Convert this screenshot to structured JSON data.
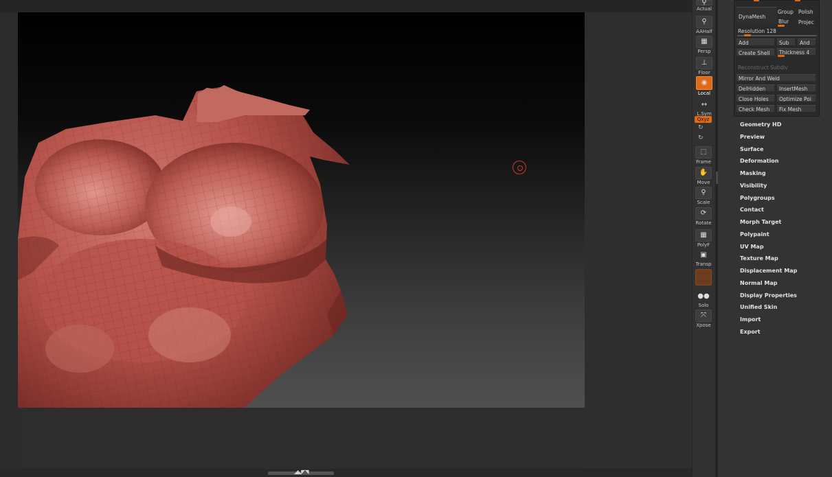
{
  "shelf": {
    "actual": "Actual",
    "aahalf": "AAHalf",
    "persp": "Persp",
    "floor": "Floor",
    "local": "Local",
    "lsym": "L.Sym",
    "xyz": "Qxyz",
    "frame": "Frame",
    "move": "Move",
    "scale": "Scale",
    "rotate": "Rotate",
    "polyf": "PolyF",
    "transp": "Transp",
    "solo": "Solo",
    "xpose": "Xpose"
  },
  "geometry": {
    "dynamesh": "DynaMesh",
    "group": "Group",
    "polish": "Polish",
    "blur": "Blur",
    "project": "Projec",
    "resolution": "Resolution 128",
    "add": "Add",
    "sub": "Sub",
    "and": "And",
    "create_shell": "Create Shell",
    "thickness": "Thickness 4",
    "reconstruct": "Reconstruct Subdiv",
    "mirror_weld": "Mirror And Weld",
    "del_hidden": "DelHidden",
    "insert_mesh": "InsertMesh",
    "close_holes": "Close Holes",
    "optimize": "Optimize Poi",
    "check_mesh": "Check Mesh",
    "fix_mesh": "Fix Mesh"
  },
  "menu_items": [
    "Geometry HD",
    "Preview",
    "Surface",
    "Deformation",
    "Masking",
    "Visibility",
    "Polygroups",
    "Contact",
    "Morph Target",
    "Polypaint",
    "UV Map",
    "Texture Map",
    "Displacement Map",
    "Normal Map",
    "Display Properties",
    "Unified Skin",
    "Import",
    "Export"
  ],
  "colors": {
    "accent": "#e06a15",
    "model": "#b5524a"
  }
}
